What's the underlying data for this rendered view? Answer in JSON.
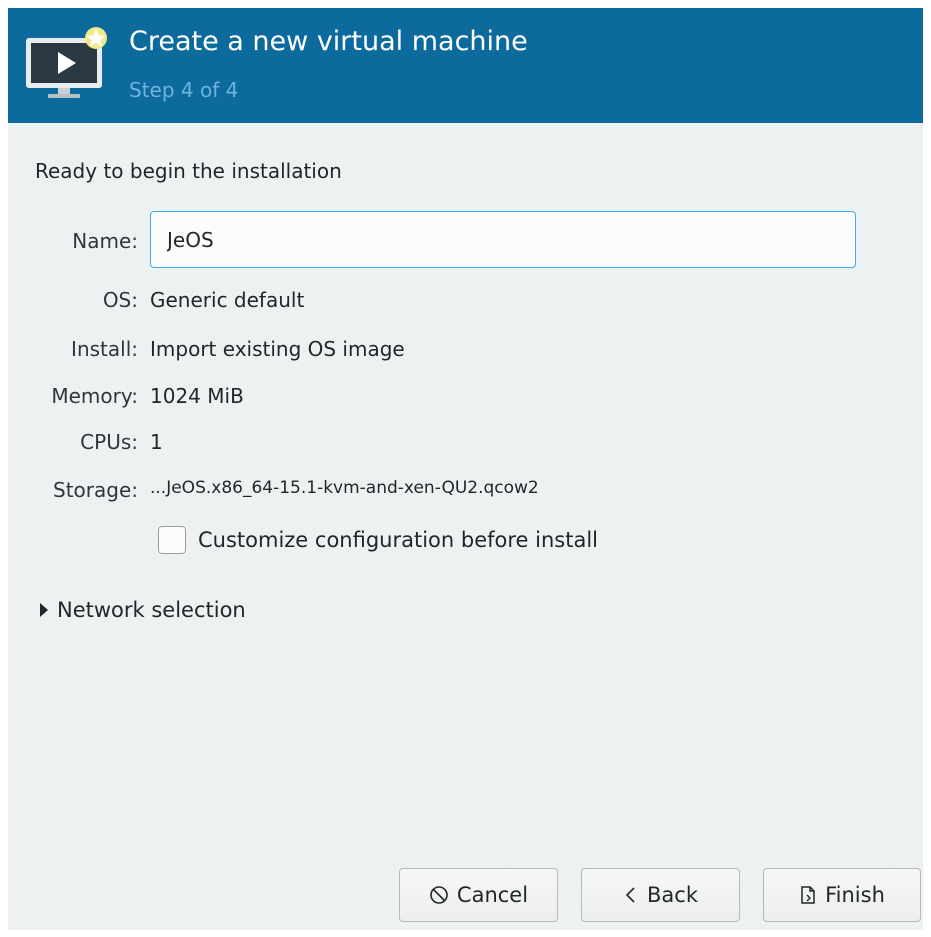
{
  "header": {
    "title": "Create a new virtual machine",
    "subtitle": "Step 4 of 4",
    "icon": "monitor-play-new-icon",
    "color": "#0c6a9c"
  },
  "main": {
    "heading": "Ready to begin the installation",
    "fields": {
      "name": {
        "label": "Name:",
        "value": "JeOS"
      },
      "os": {
        "label": "OS:",
        "value": "Generic default"
      },
      "install": {
        "label": "Install:",
        "value": "Import existing OS image"
      },
      "memory": {
        "label": "Memory:",
        "value": "1024 MiB"
      },
      "cpus": {
        "label": "CPUs:",
        "value": "1"
      },
      "storage": {
        "label": "Storage:",
        "value": "...JeOS.x86_64-15.1-kvm-and-xen-QU2.qcow2"
      }
    },
    "customize": {
      "label": "Customize configuration before install",
      "checked": false
    },
    "network": {
      "label": "Network selection",
      "expanded": false
    }
  },
  "buttons": {
    "cancel": {
      "label": "Cancel",
      "icon": "cancel-circle-icon"
    },
    "back": {
      "label": "Back",
      "icon": "chevron-left-icon"
    },
    "finish": {
      "label": "Finish",
      "icon": "document-finish-icon"
    }
  }
}
